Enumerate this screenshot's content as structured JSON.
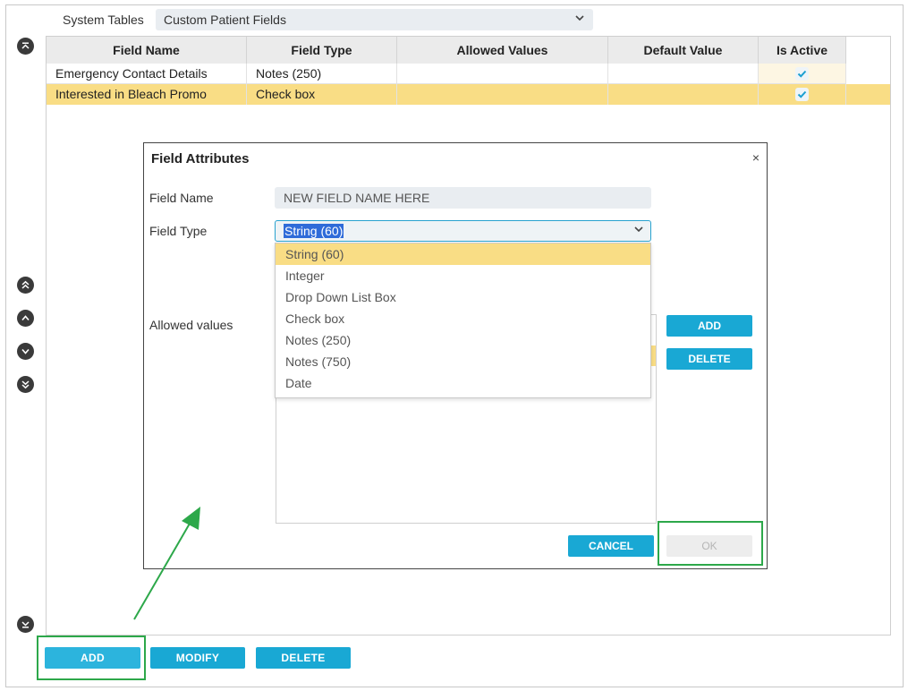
{
  "header": {
    "system_tables_label": "System Tables",
    "table_select_value": "Custom Patient Fields"
  },
  "grid": {
    "columns": [
      "Field Name",
      "Field Type",
      "Allowed Values",
      "Default Value",
      "Is Active"
    ],
    "rows": [
      {
        "field_name": "Emergency Contact Details",
        "field_type": "Notes (250)",
        "allowed_values": "",
        "default_value": "",
        "is_active": true
      },
      {
        "field_name": "Interested in Bleach Promo",
        "field_type": "Check box",
        "allowed_values": "",
        "default_value": "",
        "is_active": true
      }
    ]
  },
  "buttons": {
    "add": "ADD",
    "modify": "MODIFY",
    "delete": "DELETE"
  },
  "dialog": {
    "title": "Field Attributes",
    "close_glyph": "×",
    "field_name_label": "Field Name",
    "field_name_value": "NEW FIELD NAME HERE",
    "field_type_label": "Field Type",
    "field_type_value": "String (60)",
    "field_type_options": [
      "String (60)",
      "Integer",
      "Drop Down List Box",
      "Check box",
      "Notes (250)",
      "Notes (750)",
      "Date"
    ],
    "allowed_values_label": "Allowed values",
    "add_button": "ADD",
    "delete_button": "DELETE",
    "cancel_button": "CANCEL",
    "ok_button": "OK"
  },
  "colors": {
    "accent": "#19a8d4",
    "selection": "#f9dd85",
    "highlight": "#2da84a"
  },
  "icons": [
    "move-top-icon",
    "move-up-fast-icon",
    "move-up-icon",
    "move-down-icon",
    "move-down-fast-icon",
    "move-bottom-icon",
    "checkmark-icon",
    "chevron-down-icon",
    "close-icon"
  ]
}
